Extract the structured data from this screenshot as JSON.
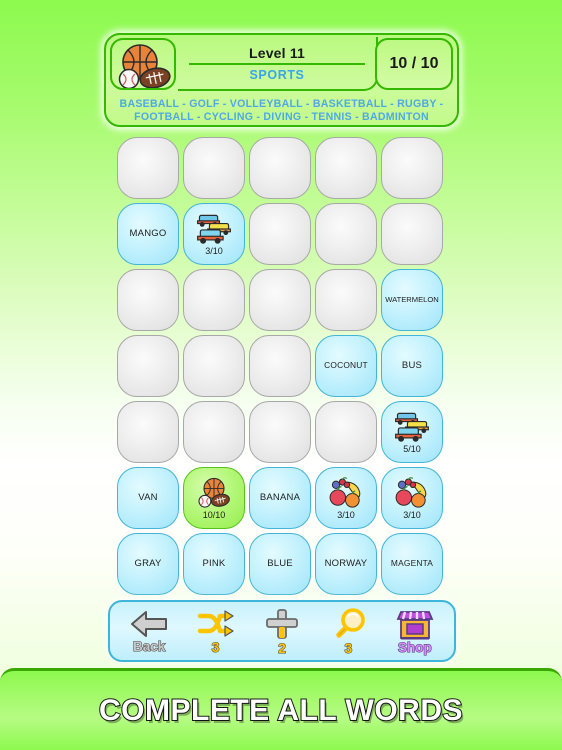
{
  "header": {
    "icon": "sports-balls-icon",
    "level_label": "Level 11",
    "category": "SPORTS",
    "score": "10 / 10",
    "word_lines": [
      "BASEBALL - GOLF - VOLLEYBALL - BASKETBALL - RUGBY -",
      "FOOTBALL - CYCLING - DIVING - TENNIS - BADMINTON"
    ]
  },
  "grid": {
    "columns": 5,
    "rows": 7,
    "cells": [
      {
        "state": "empty",
        "label": "",
        "icon": "",
        "count": ""
      },
      {
        "state": "empty",
        "label": "",
        "icon": "",
        "count": ""
      },
      {
        "state": "empty",
        "label": "",
        "icon": "",
        "count": ""
      },
      {
        "state": "empty",
        "label": "",
        "icon": "",
        "count": ""
      },
      {
        "state": "empty",
        "label": "",
        "icon": "",
        "count": ""
      },
      {
        "state": "word",
        "label": "MANGO",
        "icon": "",
        "count": ""
      },
      {
        "state": "word",
        "label": "",
        "icon": "cars-icon",
        "count": "3/10"
      },
      {
        "state": "empty",
        "label": "",
        "icon": "",
        "count": ""
      },
      {
        "state": "empty",
        "label": "",
        "icon": "",
        "count": ""
      },
      {
        "state": "empty",
        "label": "",
        "icon": "",
        "count": ""
      },
      {
        "state": "empty",
        "label": "",
        "icon": "",
        "count": ""
      },
      {
        "state": "empty",
        "label": "",
        "icon": "",
        "count": ""
      },
      {
        "state": "empty",
        "label": "",
        "icon": "",
        "count": ""
      },
      {
        "state": "empty",
        "label": "",
        "icon": "",
        "count": ""
      },
      {
        "state": "word",
        "label": "WATERMELON",
        "icon": "",
        "count": ""
      },
      {
        "state": "empty",
        "label": "",
        "icon": "",
        "count": ""
      },
      {
        "state": "empty",
        "label": "",
        "icon": "",
        "count": ""
      },
      {
        "state": "empty",
        "label": "",
        "icon": "",
        "count": ""
      },
      {
        "state": "word",
        "label": "COCONUT",
        "icon": "",
        "count": ""
      },
      {
        "state": "word",
        "label": "BUS",
        "icon": "",
        "count": ""
      },
      {
        "state": "empty",
        "label": "",
        "icon": "",
        "count": ""
      },
      {
        "state": "empty",
        "label": "",
        "icon": "",
        "count": ""
      },
      {
        "state": "empty",
        "label": "",
        "icon": "",
        "count": ""
      },
      {
        "state": "empty",
        "label": "",
        "icon": "",
        "count": ""
      },
      {
        "state": "word",
        "label": "",
        "icon": "cars-icon",
        "count": "5/10"
      },
      {
        "state": "word",
        "label": "VAN",
        "icon": "",
        "count": ""
      },
      {
        "state": "done",
        "label": "",
        "icon": "sports-balls-icon",
        "count": "10/10"
      },
      {
        "state": "word",
        "label": "BANANA",
        "icon": "",
        "count": ""
      },
      {
        "state": "word",
        "label": "",
        "icon": "fruits-icon",
        "count": "3/10"
      },
      {
        "state": "word",
        "label": "",
        "icon": "fruits-icon",
        "count": "3/10"
      },
      {
        "state": "word",
        "label": "GRAY",
        "icon": "",
        "count": ""
      },
      {
        "state": "word",
        "label": "PINK",
        "icon": "",
        "count": ""
      },
      {
        "state": "word",
        "label": "BLUE",
        "icon": "",
        "count": ""
      },
      {
        "state": "word",
        "label": "NORWAY",
        "icon": "",
        "count": ""
      },
      {
        "state": "word",
        "label": "MAGENTA",
        "icon": "",
        "count": ""
      }
    ]
  },
  "toolbar": {
    "items": [
      {
        "icon": "back-arrow-icon",
        "caption": "Back"
      },
      {
        "icon": "shuffle-icon",
        "caption": "3"
      },
      {
        "icon": "plus-icon",
        "caption": "2"
      },
      {
        "icon": "magnifier-icon",
        "caption": "3"
      },
      {
        "icon": "shop-icon",
        "caption": "Shop"
      }
    ]
  },
  "banner": {
    "text": "COMPLETE ALL WORDS"
  },
  "colors": {
    "background_top": "#8df94e",
    "panel_green": "#c9fb9c",
    "panel_border": "#35b800",
    "word_cell": "#c5f2fd",
    "word_cell_border": "#44b4d8",
    "done_cell": "#b4f779",
    "done_cell_border": "#54c41a",
    "empty_cell": "#eeeeee",
    "empty_cell_border": "#a8a8a8",
    "category_text": "#3aa5e8",
    "word_list_text": "#4fa9e4",
    "toolbar_bg": "#d2f5fd",
    "toolbar_border": "#3fb5da",
    "gold": "#ffc400",
    "shop_purple": "#9b27b0"
  }
}
